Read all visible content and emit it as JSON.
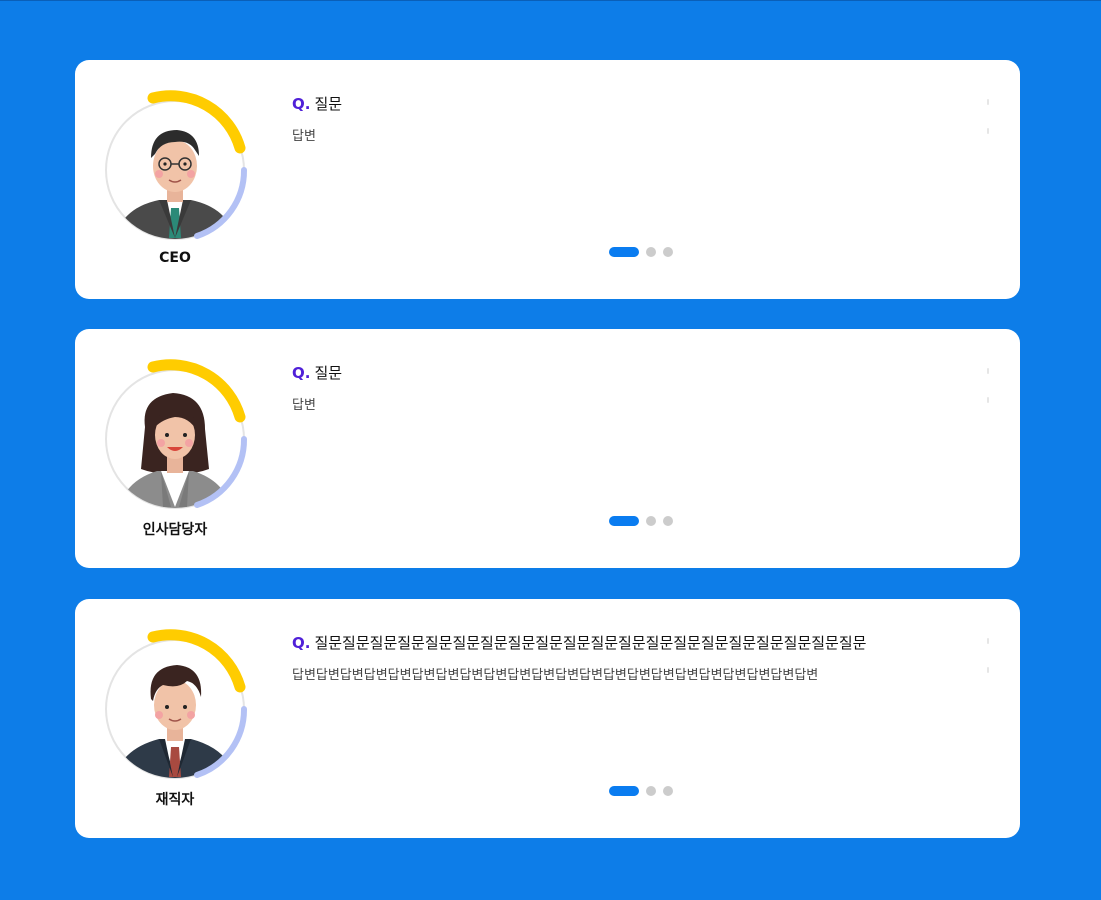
{
  "colors": {
    "background": "#0d7de8",
    "card": "#ffffff",
    "question_prefix": "#5020d8",
    "dot_active": "#0a7cf0",
    "dot_inactive": "#cccccc",
    "ring_gold": "#ffcc00",
    "ring_lavender": "#b3c1f5"
  },
  "cards": [
    {
      "role": "CEO",
      "avatar": "ceo-avatar-illustration",
      "question_prefix": "Q.",
      "question": "질문",
      "answer": "답변",
      "pagination": {
        "pages": 3,
        "active": 1
      }
    },
    {
      "role": "인사담당자",
      "avatar": "hr-manager-avatar-illustration",
      "question_prefix": "Q.",
      "question": "질문",
      "answer": "답변",
      "pagination": {
        "pages": 3,
        "active": 1
      }
    },
    {
      "role": "재직자",
      "avatar": "employee-avatar-illustration",
      "question_prefix": "Q.",
      "question": "질문질문질문질문질문질문질문질문질문질문질문질문질문질문질문질문질문질문질문질문",
      "answer": "답변답변답변답변답변답변답변답변답변답변답변답변답변답변답변답변답변답변답변답변답변답변",
      "pagination": {
        "pages": 3,
        "active": 1
      }
    }
  ]
}
